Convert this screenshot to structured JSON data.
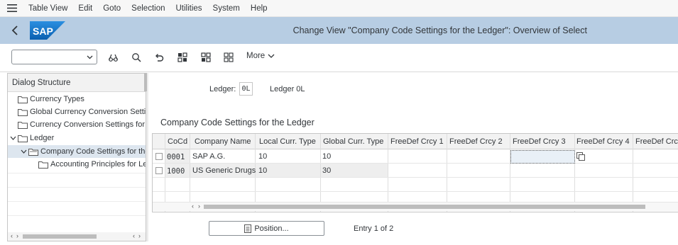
{
  "menu": {
    "items": [
      "Table View",
      "Edit",
      "Goto",
      "Selection",
      "Utilities",
      "System",
      "Help"
    ]
  },
  "titlebar": {
    "title": "Change View \"Company Code Settings for the Ledger\": Overview of Select",
    "logo": "SAP"
  },
  "toolbar": {
    "variant_value": "",
    "more_label": "More",
    "icons": [
      "glasses-icon",
      "find-icon",
      "undo-icon",
      "select-all-icon",
      "select-block-icon",
      "deselect-all-icon"
    ]
  },
  "dialog_structure": {
    "header": "Dialog Structure",
    "items": [
      {
        "label": "Currency Types",
        "level": 1,
        "expanded": null,
        "selected": false
      },
      {
        "label": "Global Currency Conversion Settin",
        "level": 1,
        "expanded": null,
        "selected": false
      },
      {
        "label": "Currency Conversion Settings for C",
        "level": 1,
        "expanded": null,
        "selected": false
      },
      {
        "label": "Ledger",
        "level": 1,
        "expanded": true,
        "selected": false
      },
      {
        "label": "Company Code Settings for the",
        "level": 2,
        "expanded": true,
        "selected": true
      },
      {
        "label": "Accounting Principles for Led",
        "level": 3,
        "expanded": null,
        "selected": false
      }
    ]
  },
  "ledger_field": {
    "label": "Ledger:",
    "value": "0L",
    "description": "Ledger 0L"
  },
  "section_title": "Company Code Settings for the Ledger",
  "table": {
    "columns": [
      "CoCd",
      "Company Name",
      "Local Curr. Type",
      "Global Curr. Type",
      "FreeDef Crcy 1",
      "FreeDef Crcy 2",
      "FreeDef Crcy 3",
      "FreeDef Crcy 4",
      "FreeDef Crc"
    ],
    "rows": [
      {
        "cocd": "0001",
        "company": "SAP A.G.",
        "local": "10",
        "global": "10"
      },
      {
        "cocd": "1000",
        "company": "US Generic Drugs",
        "local": "10",
        "global": "30"
      }
    ]
  },
  "position_button": "Position...",
  "entry_info": "Entry 1 of 2",
  "colors": {
    "titlebar_bg": "#b7cde3",
    "sap_logo_blue": "#1a73c7",
    "selected_tree_bg": "#dde6ef"
  }
}
